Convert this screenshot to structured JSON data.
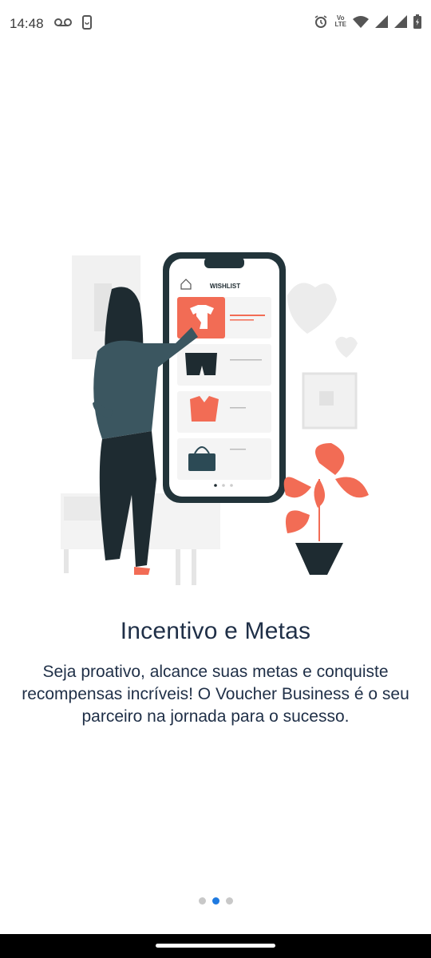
{
  "status": {
    "time": "14:48",
    "network_label_top": "Vo",
    "network_label_bottom": "LTE"
  },
  "illustration": {
    "wishlist_label": "WISHLIST"
  },
  "onboarding": {
    "title": "Incentivo e Metas",
    "description": "Seja proativo, alcance suas metas e conquiste recompensas incríveis! O Voucher Business é o seu parceiro na jornada para o sucesso.",
    "page_count": 3,
    "active_page": 2
  },
  "colors": {
    "title": "#1f2f47",
    "accent": "#1f7ae0",
    "coral": "#f26c55",
    "dark": "#1e2b31"
  }
}
